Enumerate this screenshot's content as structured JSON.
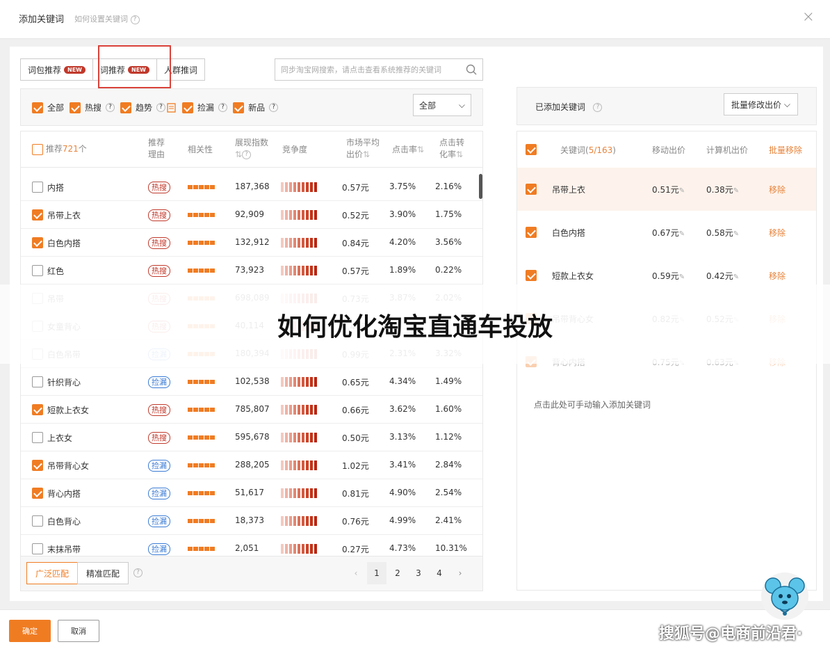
{
  "header": {
    "title": "添加关键词",
    "help": "如何设置关键词",
    "close": "×"
  },
  "tabs": [
    {
      "label": "词包推荐",
      "badge": "NEW"
    },
    {
      "label": "词推荐",
      "badge": "NEW"
    },
    {
      "label": "人群推词",
      "badge": ""
    }
  ],
  "search": {
    "placeholder": "同步淘宝网搜索，请点击查看系统推荐的关键词"
  },
  "filters": [
    {
      "label": "全部",
      "checked": true
    },
    {
      "label": "热搜",
      "checked": true
    },
    {
      "label": "趋势",
      "checked": true
    },
    {
      "label": "捡漏",
      "checked": true
    },
    {
      "label": "新品",
      "checked": true
    }
  ],
  "filter_select": "全部",
  "left_table": {
    "headers": {
      "recommend_prefix": "推荐",
      "recommend_count": "721",
      "recommend_suffix": "个",
      "reason": "推荐\n理由",
      "relevance": "相关性",
      "impressions": "展现指数",
      "competition": "竞争度",
      "avg_bid": "市场平均\n出价",
      "ctr": "点击率",
      "cvr": "点击转\n化率"
    },
    "rows": [
      {
        "kw": "内搭",
        "checked": false,
        "tag": "热搜",
        "tagtype": "hot",
        "imp": "187,368",
        "bid": "0.57元",
        "ctr": "3.75%",
        "cvr": "2.16%",
        "faded": false
      },
      {
        "kw": "吊带上衣",
        "checked": true,
        "tag": "热搜",
        "tagtype": "hot",
        "imp": "92,909",
        "bid": "0.52元",
        "ctr": "3.90%",
        "cvr": "1.75%",
        "faded": false
      },
      {
        "kw": "白色内搭",
        "checked": true,
        "tag": "热搜",
        "tagtype": "hot",
        "imp": "132,912",
        "bid": "0.84元",
        "ctr": "4.20%",
        "cvr": "3.56%",
        "faded": false
      },
      {
        "kw": "红色",
        "checked": false,
        "tag": "热搜",
        "tagtype": "hot",
        "imp": "73,923",
        "bid": "0.57元",
        "ctr": "1.89%",
        "cvr": "0.22%",
        "faded": false
      },
      {
        "kw": "吊带",
        "checked": false,
        "tag": "热搜",
        "tagtype": "hot",
        "imp": "698,089",
        "bid": "0.73元",
        "ctr": "3.87%",
        "cvr": "2.02%",
        "faded": true
      },
      {
        "kw": "女童背心",
        "checked": false,
        "tag": "热搜",
        "tagtype": "hot",
        "imp": "40,114",
        "bid": "0.46元",
        "ctr": "",
        "cvr": "",
        "faded": true
      },
      {
        "kw": "白色吊带",
        "checked": false,
        "tag": "捡漏",
        "tagtype": "miss",
        "imp": "180,394",
        "bid": "0.99元",
        "ctr": "2.31%",
        "cvr": "3.32%",
        "faded": true
      },
      {
        "kw": "针织背心",
        "checked": false,
        "tag": "捡漏",
        "tagtype": "miss",
        "imp": "102,538",
        "bid": "0.65元",
        "ctr": "4.34%",
        "cvr": "1.49%",
        "faded": false
      },
      {
        "kw": "短款上衣女",
        "checked": true,
        "tag": "热搜",
        "tagtype": "hot",
        "imp": "785,807",
        "bid": "0.66元",
        "ctr": "3.62%",
        "cvr": "1.60%",
        "faded": false
      },
      {
        "kw": "上衣女",
        "checked": false,
        "tag": "热搜",
        "tagtype": "hot",
        "imp": "595,678",
        "bid": "0.50元",
        "ctr": "3.13%",
        "cvr": "1.12%",
        "faded": false
      },
      {
        "kw": "吊带背心女",
        "checked": true,
        "tag": "捡漏",
        "tagtype": "miss",
        "imp": "288,205",
        "bid": "1.02元",
        "ctr": "3.41%",
        "cvr": "2.84%",
        "faded": false
      },
      {
        "kw": "背心内搭",
        "checked": true,
        "tag": "捡漏",
        "tagtype": "miss",
        "imp": "51,617",
        "bid": "0.81元",
        "ctr": "4.90%",
        "cvr": "2.54%",
        "faded": false
      },
      {
        "kw": "白色背心",
        "checked": false,
        "tag": "捡漏",
        "tagtype": "miss",
        "imp": "18,373",
        "bid": "0.76元",
        "ctr": "4.99%",
        "cvr": "2.41%",
        "faded": false
      },
      {
        "kw": "末抹吊带",
        "checked": false,
        "tag": "捡漏",
        "tagtype": "miss",
        "imp": "2,051",
        "bid": "0.27元",
        "ctr": "4.73%",
        "cvr": "10.31%",
        "faded": false
      }
    ]
  },
  "match": {
    "broad": "广泛匹配",
    "exact": "精准匹配"
  },
  "pager": {
    "pages": [
      "1",
      "2",
      "3",
      "4"
    ],
    "current": "1"
  },
  "right": {
    "added_label": "已添加关键词",
    "batch_bid": "批量修改出价",
    "headers": {
      "kw_prefix": "关键词(",
      "kw_count": "5/163",
      "kw_suffix": ")",
      "mobile": "移动出价",
      "pc": "计算机出价",
      "batch_remove": "批量移除"
    },
    "rows": [
      {
        "kw": "吊带上衣",
        "mobile": "0.51元",
        "pc": "0.38元",
        "action": "移除",
        "faded": false,
        "hl": true
      },
      {
        "kw": "白色内搭",
        "mobile": "0.67元",
        "pc": "0.58元",
        "action": "移除",
        "faded": false,
        "hl": false
      },
      {
        "kw": "短款上衣女",
        "mobile": "0.59元",
        "pc": "0.42元",
        "action": "移除",
        "faded": false,
        "hl": false
      },
      {
        "kw": "吊带背心女",
        "mobile": "0.82元",
        "pc": "0.52元",
        "action": "移除",
        "faded": true,
        "hl": false
      },
      {
        "kw": "背心内搭",
        "mobile": "0.75元",
        "pc": "0.63元",
        "action": "移除",
        "faded": true,
        "hl": false
      }
    ],
    "hint": "点击此处可手动输入添加关键词"
  },
  "footer": {
    "ok": "确定",
    "cancel": "取消"
  },
  "overlay_title": "如何优化淘宝直通车投放",
  "watermark": "搜狐号@电商前沿君·"
}
